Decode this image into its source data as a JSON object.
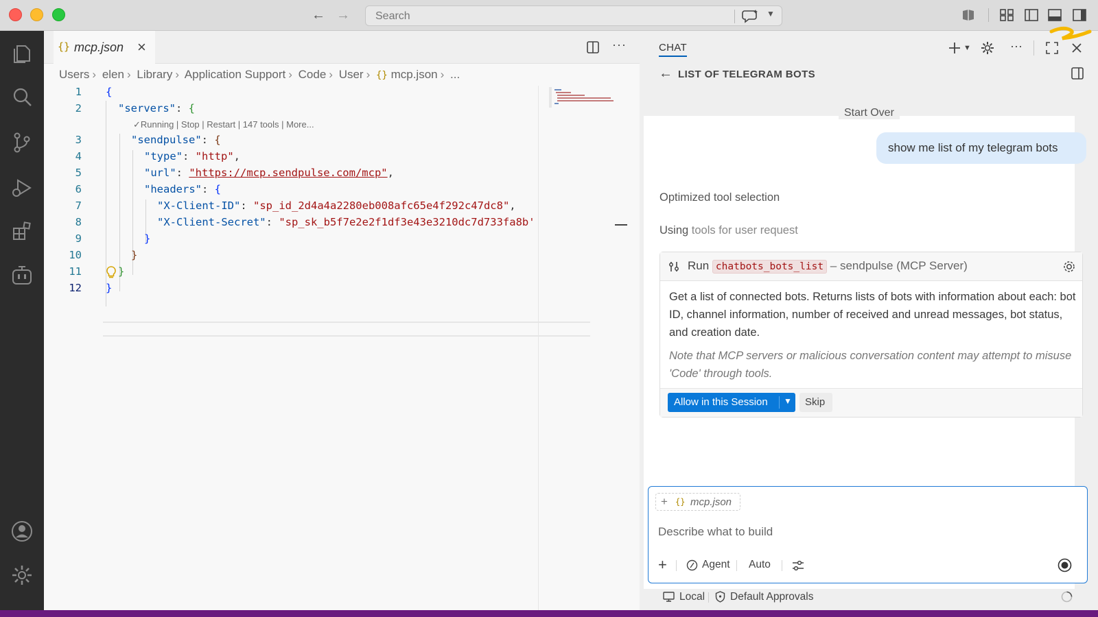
{
  "titlebar": {
    "search_placeholder": "Search"
  },
  "editor": {
    "tab_filename": "mcp.json",
    "tab_icon_text": "{}",
    "breadcrumb": [
      "Users",
      "elen",
      "Library",
      "Application Support",
      "Code",
      "User",
      "mcp.json",
      "..."
    ],
    "codelens": "✓Running | Stop | Restart | 147 tools | More...",
    "line_numbers": [
      "1",
      "2",
      "3",
      "4",
      "5",
      "6",
      "7",
      "8",
      "9",
      "10",
      "11",
      "12"
    ],
    "code": {
      "l1_open": "{",
      "l2_key": "\"servers\"",
      "l3_key": "\"sendpulse\"",
      "l4_key": "\"type\"",
      "l4_val": "\"http\"",
      "l5_key": "\"url\"",
      "l5_val": "\"https://mcp.sendpulse.com/mcp\"",
      "l6_key": "\"headers\"",
      "l7_key": "\"X-Client-ID\"",
      "l7_val": "\"sp_id_2d4a4a2280eb008afc65e4f292c47dc8\"",
      "l8_key": "\"X-Client-Secret\"",
      "l8_val": "\"sp_sk_b5f7e2e2f1df3e43e3210dc7d733fa8b'"
    }
  },
  "chat": {
    "tab_label": "CHAT",
    "session_title": "LIST OF TELEGRAM BOTS",
    "start_over": "Start Over",
    "user_message": "show me list of my telegram bots",
    "progress_1": "Optimized tool selection",
    "progress_2_lead": "Using",
    "progress_2_rest": "tools for user request",
    "tool_card": {
      "run_label": "Run",
      "tool_name": "chatbots_bots_list",
      "server_label": "– sendpulse (MCP Server)",
      "description": "Get a list of connected bots. Returns lists of bots with information about each: bot ID, channel information, number of received and unread messages, bot status, and creation date.",
      "note": "Note that MCP servers or malicious conversation content may attempt to misuse 'Code' through tools.",
      "allow_label": "Allow in this Session",
      "skip_label": "Skip"
    },
    "input": {
      "context_file": "mcp.json",
      "placeholder": "Describe what to build",
      "mode": "Agent",
      "model": "Auto"
    },
    "status": {
      "location": "Local",
      "approvals": "Default Approvals"
    }
  },
  "colors": {
    "accent": "#0a79d9",
    "statusbar": "#6a1b7e",
    "activitybar": "#2c2c2c"
  },
  "icons": [
    "explorer-icon",
    "search-icon",
    "source-control-icon",
    "run-debug-icon",
    "extensions-icon",
    "copilot-icon",
    "account-icon",
    "manage-gear-icon"
  ]
}
